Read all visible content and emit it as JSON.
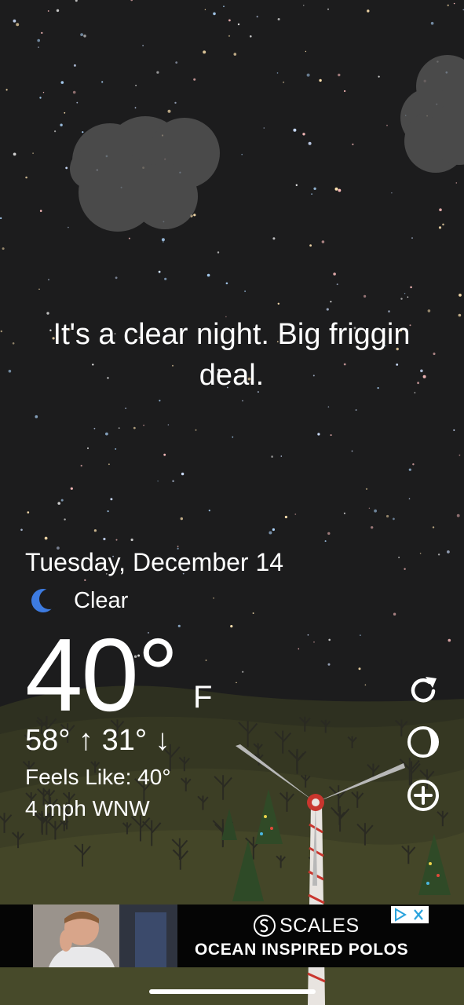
{
  "headline": "It's a clear night. Big friggin deal.",
  "date": "Tuesday, December 14",
  "condition": {
    "icon": "crescent-moon-icon",
    "text": "Clear"
  },
  "temperature": {
    "value": "40°",
    "unit": "F"
  },
  "high_low": "58° ↑  31° ↓",
  "feels_like": "Feels Like: 40°",
  "wind": "4 mph WNW",
  "actions": {
    "refresh_icon": "refresh-icon",
    "moon_phase_icon": "moon-phase-icon",
    "add_icon": "add-location-icon"
  },
  "ad": {
    "brand": "SCALES",
    "tagline": "OCEAN INSPIRED POLOS",
    "adchoices_icon": "adchoices-icon",
    "close_icon": "close-icon"
  },
  "colors": {
    "sky": "#1c1c1d",
    "hills": "#3f4127",
    "moon_icon": "#3d7be0"
  }
}
